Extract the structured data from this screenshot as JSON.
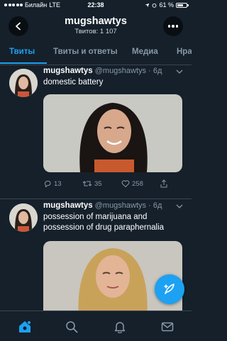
{
  "status_bar": {
    "carrier": "Билайн",
    "network": "LTE",
    "time": "22:38",
    "battery": "61 %"
  },
  "header": {
    "title": "mugshawtys",
    "subtitle": "Твитов: 1 107"
  },
  "tabs": [
    {
      "label": "Твиты",
      "active": true
    },
    {
      "label": "Твиты и ответы",
      "active": false
    },
    {
      "label": "Медиа",
      "active": false
    },
    {
      "label": "Нра",
      "active": false
    }
  ],
  "tweets": [
    {
      "name": "mugshawtys",
      "handle": "@mugshawtys",
      "separator": "·",
      "time": "6д",
      "text": "domestic battery",
      "replies": "13",
      "retweets": "35",
      "likes": "258"
    },
    {
      "name": "mugshawtys",
      "handle": "@mugshawtys",
      "separator": "·",
      "time": "6д",
      "text": "possession of marijuana and possession of drug paraphernalia"
    }
  ],
  "colors": {
    "background": "#15202b",
    "accent": "#1da1f2",
    "muted": "#8899a6",
    "divider": "#38444d"
  },
  "icons": {
    "back": "chevron-left-icon",
    "more": "more-dots-icon",
    "reply": "reply-icon",
    "retweet": "retweet-icon",
    "like": "heart-icon",
    "share": "share-icon",
    "compose": "feather-compose-icon",
    "home": "home-icon",
    "search": "search-icon",
    "notifications": "bell-icon",
    "messages": "envelope-icon"
  }
}
